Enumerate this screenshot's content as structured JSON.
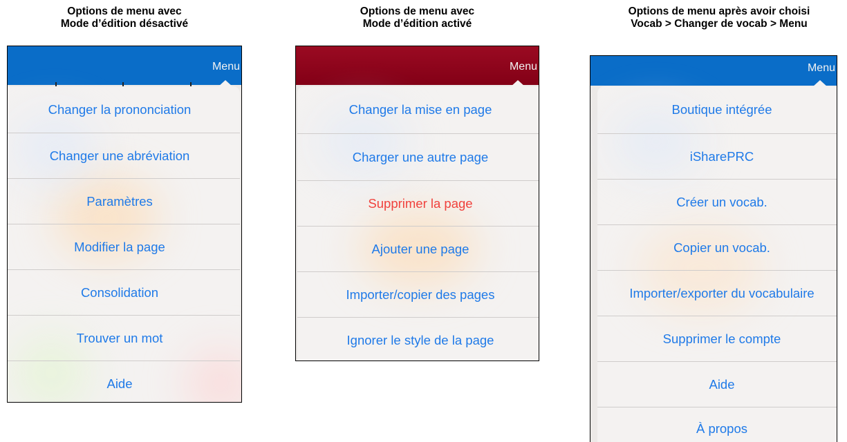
{
  "panels": [
    {
      "caption_line1": "Options de menu avec",
      "caption_line2": "Mode d’édition désactivé",
      "menu_label": "Menu",
      "items": [
        {
          "label": "Changer la prononciation"
        },
        {
          "label": "Changer une abréviation"
        },
        {
          "label": "Paramètres"
        },
        {
          "label": "Modifier la page"
        },
        {
          "label": "Consolidation"
        },
        {
          "label": "Trouver un mot"
        },
        {
          "label": "Aide"
        }
      ]
    },
    {
      "caption_line1": "Options de menu avec",
      "caption_line2": "Mode d’édition activé",
      "menu_label": "Menu",
      "items": [
        {
          "label": "Changer la mise en page"
        },
        {
          "label": "Charger une autre page"
        },
        {
          "label": "Supprimer la page",
          "destructive": true
        },
        {
          "label": "Ajouter une page"
        },
        {
          "label": "Importer/copier des pages"
        },
        {
          "label": "Ignorer le style de la page"
        }
      ]
    },
    {
      "caption_line1": "Options de menu après avoir choisi",
      "caption_line2": "Vocab > Changer de vocab > Menu",
      "menu_label": "Menu",
      "items": [
        {
          "label": "Boutique intégrée"
        },
        {
          "label": "iSharePRC"
        },
        {
          "label": "Créer un vocab."
        },
        {
          "label": "Copier un vocab."
        },
        {
          "label": "Importer/exporter du vocabulaire"
        },
        {
          "label": "Supprimer le compte"
        },
        {
          "label": "Aide"
        },
        {
          "label": "À propos"
        }
      ]
    }
  ],
  "colors": {
    "nav_blue": "#0a6dc8",
    "nav_red": "#8c0419",
    "item_text": "#1f7ae8",
    "destructive_text": "#f0413c"
  }
}
